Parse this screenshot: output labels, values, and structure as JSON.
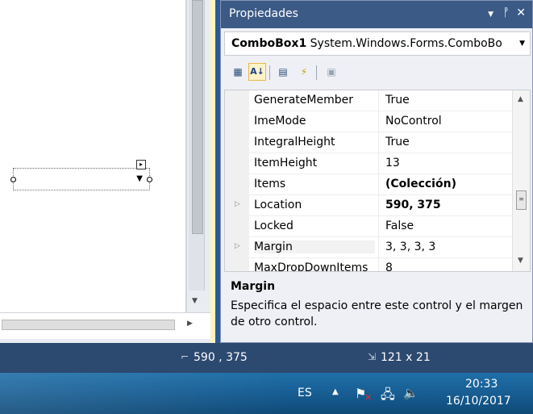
{
  "properties_panel": {
    "title": "Propiedades",
    "controls": {
      "dropdown": "▼",
      "pin": "ᚡ",
      "close": "✕"
    },
    "object": {
      "name": "ComboBox1",
      "type": "System.Windows.Forms.ComboBo"
    },
    "toolbar": [
      "categorized-icon",
      "alphabetical-icon",
      "properties-icon",
      "events-icon",
      "property-pages-icon"
    ],
    "rows": [
      {
        "name": "GenerateMember",
        "value": "True",
        "bold": false,
        "expandable": false
      },
      {
        "name": "ImeMode",
        "value": "NoControl",
        "bold": false,
        "expandable": false
      },
      {
        "name": "IntegralHeight",
        "value": "True",
        "bold": false,
        "expandable": false
      },
      {
        "name": "ItemHeight",
        "value": "13",
        "bold": false,
        "expandable": false
      },
      {
        "name": "Items",
        "value": "(Colección)",
        "bold": true,
        "expandable": false
      },
      {
        "name": "Location",
        "value": "590, 375",
        "bold": true,
        "expandable": true
      },
      {
        "name": "Locked",
        "value": "False",
        "bold": false,
        "expandable": false
      },
      {
        "name": "Margin",
        "value": "3, 3, 3, 3",
        "bold": false,
        "expandable": true
      },
      {
        "name": "MaxDropDownItems",
        "value": "8",
        "bold": false,
        "expandable": false
      }
    ],
    "description": {
      "title": "Margin",
      "text": "Especifica el espacio entre este control y el margen de otro control."
    }
  },
  "statusbar": {
    "position": "590 , 375",
    "size": "121 x 21"
  },
  "taskbar": {
    "language": "ES",
    "time": "20:33",
    "date": "16/10/2017"
  },
  "colors": {
    "title_bar": "#3b5a86",
    "status_bar": "#2c4970",
    "taskbar": "#185f95",
    "accent_yellow": "#fdf4bf"
  }
}
